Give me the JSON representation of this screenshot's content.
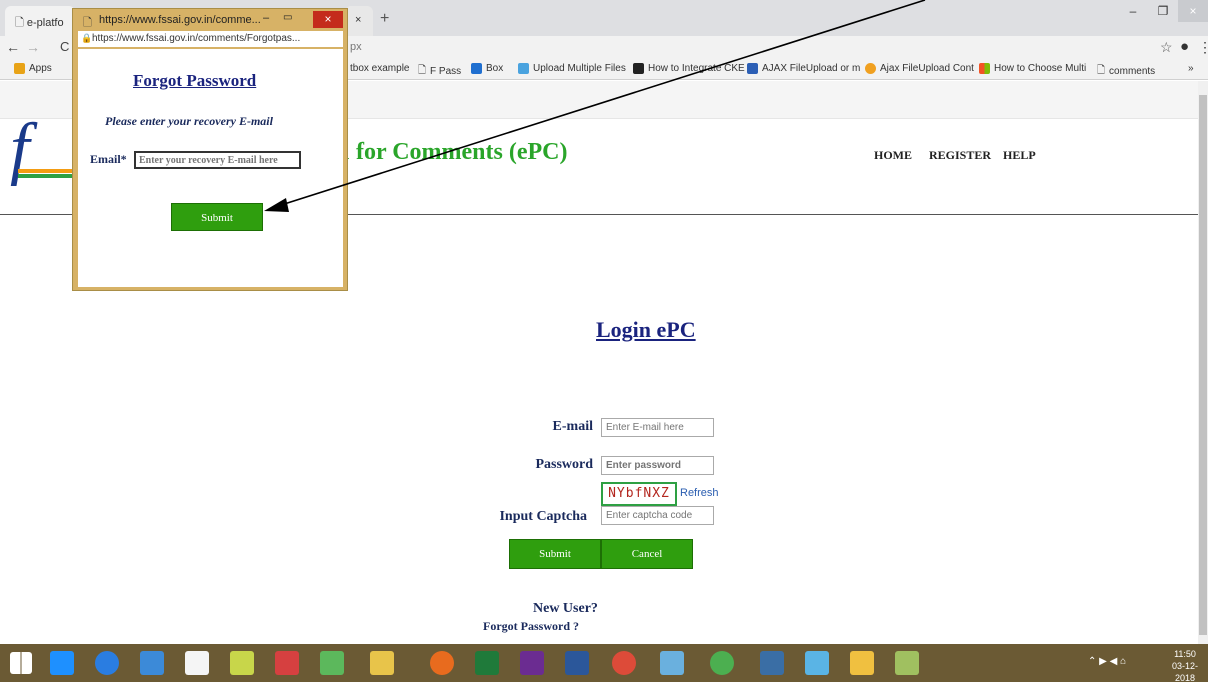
{
  "browser": {
    "tabs": [
      "e-platfo",
      "https://www.fssai.gov.in/comme..."
    ],
    "new_tab": "+",
    "url_tail": "px",
    "bookmarks": [
      {
        "label": "Apps",
        "icon": "apps-grid-icon",
        "color": "#e8a317"
      },
      {
        "label": "tbox example",
        "icon": "page-icon",
        "color": "#dddddd"
      },
      {
        "label": "F Pass",
        "icon": "page-icon",
        "color": "#dddddd"
      },
      {
        "label": "Box",
        "icon": "box-icon",
        "color": "#1f6fd0"
      },
      {
        "label": "Upload Multiple Files",
        "icon": "upload-icon",
        "color": "#4aa3df"
      },
      {
        "label": "How to Integrate CKE",
        "icon": "cb-icon",
        "color": "#222222"
      },
      {
        "label": "AJAX FileUpload or m",
        "icon": "df-icon",
        "color": "#2c5fb5"
      },
      {
        "label": "Ajax FileUpload Cont",
        "icon": "ajax-icon",
        "color": "#f0a020"
      },
      {
        "label": "How to Choose Multi",
        "icon": "windows-icon",
        "color": "#f35325"
      },
      {
        "label": "comments",
        "icon": "page-icon",
        "color": "#dddddd"
      },
      {
        "label": "»",
        "icon": "more-icon",
        "color": "#dddddd"
      }
    ]
  },
  "site": {
    "logo_letter": "f",
    "title_partial": "for Comments (ePC)",
    "title_prefix": "n",
    "nav": [
      "HOME",
      "REGISTER",
      "HELP"
    ]
  },
  "login": {
    "heading": "Login ePC",
    "email_label": "E-mail",
    "email_placeholder": "Enter E-mail here",
    "password_label": "Password",
    "password_placeholder": "Enter password",
    "captcha_text": "NYbfNXZ",
    "refresh_label": "Refresh",
    "captcha_label": "Input Captcha",
    "captcha_placeholder": "Enter captcha code",
    "submit_label": "Submit",
    "cancel_label": "Cancel",
    "new_user": "New User?",
    "forgot": "Forgot Password ?"
  },
  "popup": {
    "title": "https://www.fssai.gov.in/comme...",
    "address": "https://www.fssai.gov.in/comments/Forgotpas...",
    "heading": "Forgot Password",
    "instruction": "Please enter your recovery E-mail",
    "email_label": "Email*",
    "email_placeholder": "Enter your recovery E-mail here",
    "submit_label": "Submit"
  },
  "taskbar": {
    "time": "11:50",
    "date": "03-12-2018"
  }
}
